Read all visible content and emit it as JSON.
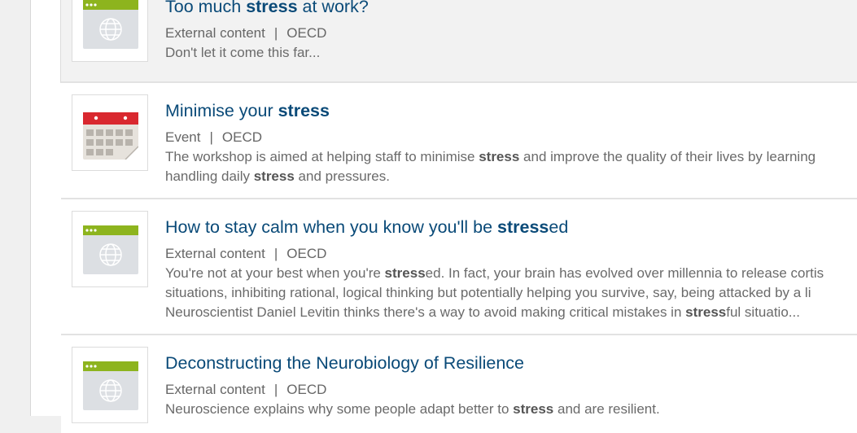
{
  "results": [
    {
      "title_pre": "Too much ",
      "title_bold": "stress",
      "title_post": " at work?",
      "type": "External content",
      "separator": "|",
      "source": "OECD",
      "lines": [
        {
          "a": "Don't let it come this far...",
          "b": "",
          "c": "",
          "d": "",
          "e": ""
        }
      ]
    },
    {
      "title_pre": "Minimise your ",
      "title_bold": "stress",
      "title_post": "",
      "type": "Event",
      "separator": "|",
      "source": "OECD",
      "lines": [
        {
          "a": "The workshop is aimed at helping staff to minimise ",
          "b": "stress",
          "c": " and improve the quality of their lives by learning",
          "d": "",
          "e": ""
        },
        {
          "a": "handling daily ",
          "b": "stress",
          "c": " and pressures.",
          "d": "",
          "e": ""
        }
      ]
    },
    {
      "title_pre": "How to stay calm when you know you'll be ",
      "title_bold": "stress",
      "title_post": "ed",
      "type": "External content",
      "separator": "|",
      "source": "OECD",
      "lines": [
        {
          "a": "You're not at your best when you're ",
          "b": "stress",
          "c": "ed. In fact, your brain has evolved over millennia to release cortis",
          "d": "",
          "e": ""
        },
        {
          "a": "situations, inhibiting rational, logical thinking but potentially helping you survive, say, being attacked by a li",
          "b": "",
          "c": "",
          "d": "",
          "e": ""
        },
        {
          "a": "Neuroscientist Daniel Levitin thinks there's a way to avoid making critical mistakes in ",
          "b": "stress",
          "c": "ful situatio...",
          "d": "",
          "e": ""
        }
      ]
    },
    {
      "title_pre": "Deconstructing the Neurobiology of Resilience",
      "title_bold": "",
      "title_post": "",
      "type": "External content",
      "separator": "|",
      "source": "OECD",
      "lines": [
        {
          "a": "Neuroscience explains why some people adapt better to ",
          "b": "stress",
          "c": " and are resilient.",
          "d": "",
          "e": ""
        }
      ]
    }
  ],
  "colors": {
    "title": "#0a4a78",
    "web_bar": "#8db41e",
    "calendar_bar": "#d9282f"
  },
  "icons": [
    "web-page-icon",
    "calendar-icon",
    "web-page-icon",
    "web-page-icon"
  ]
}
